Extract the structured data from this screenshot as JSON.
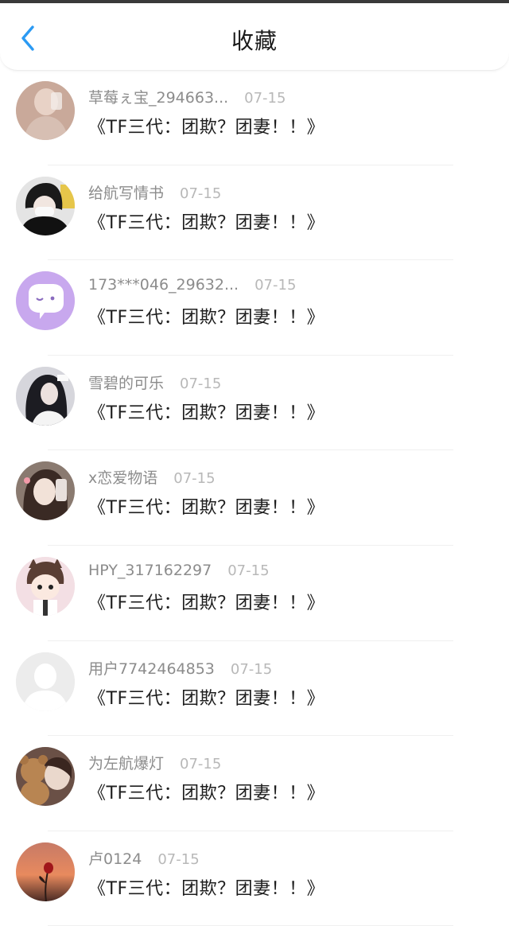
{
  "header": {
    "title": "收藏"
  },
  "items": [
    {
      "user": "草莓ぇ宝_294663...",
      "date": "07-15",
      "content": "《TF三代：团欺？团妻！！》",
      "avatar": "girl-photo-avatar-1"
    },
    {
      "user": "给航写情书",
      "date": "07-15",
      "content": "《TF三代：团欺？团妻！！》",
      "avatar": "masked-person-avatar"
    },
    {
      "user": "173***046_29632...",
      "date": "07-15",
      "content": "《TF三代：团欺？团妻！！》",
      "avatar": "purple-chat-bubble-avatar"
    },
    {
      "user": "雪碧的可乐",
      "date": "07-15",
      "content": "《TF三代：团欺？团妻！！》",
      "avatar": "dark-hair-girl-avatar"
    },
    {
      "user": "x恋爱物语",
      "date": "07-15",
      "content": "《TF三代：团欺？团妻！！》",
      "avatar": "girl-selfie-avatar"
    },
    {
      "user": "HPY_317162297",
      "date": "07-15",
      "content": "《TF三代：团欺？团妻！！》",
      "avatar": "cartoon-boy-avatar"
    },
    {
      "user": "用户7742464853",
      "date": "07-15",
      "content": "《TF三代：团欺？团妻！！》",
      "avatar": "default-gray-avatar"
    },
    {
      "user": "为左航爆灯",
      "date": "07-15",
      "content": "《TF三代：团欺？团妻！！》",
      "avatar": "teddy-bear-avatar"
    },
    {
      "user": "卢0124",
      "date": "07-15",
      "content": "《TF三代：团欺？团妻！！》",
      "avatar": "rose-sunset-avatar"
    }
  ],
  "colors": {
    "accent": "#2b9af3",
    "text": "#1e1e1e",
    "meta": "#8c8c8c",
    "date": "#b8b8b8"
  }
}
